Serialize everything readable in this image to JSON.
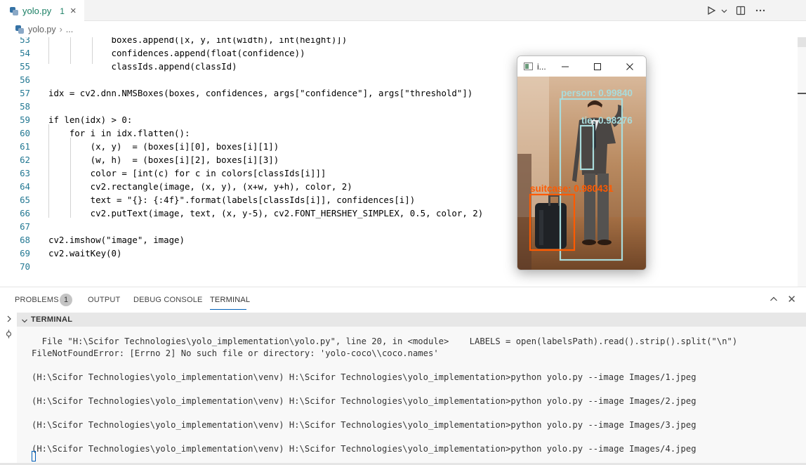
{
  "tab": {
    "label": "yolo.py",
    "badge": "1",
    "close": "×",
    "icon": "python-file-icon"
  },
  "toolbar": {
    "run_icon": "run-icon",
    "dropdown_icon": "chevron-down-icon",
    "split_icon": "split-editor-icon",
    "more_icon": "more-actions-icon"
  },
  "breadcrumb": {
    "file": "yolo.py",
    "sep": "›",
    "more": "..."
  },
  "editor": {
    "lines": [
      {
        "n": "53",
        "text": "            boxes.append([x, y, int(width), int(height)])"
      },
      {
        "n": "54",
        "text": "            confidences.append(float(confidence))"
      },
      {
        "n": "55",
        "text": "            classIds.append(classId)"
      },
      {
        "n": "56",
        "text": ""
      },
      {
        "n": "57",
        "text": "idx = cv2.dnn.NMSBoxes(boxes, confidences, args[\"confidence\"], args[\"threshold\"])"
      },
      {
        "n": "58",
        "text": ""
      },
      {
        "n": "59",
        "text": "if len(idx) > 0:"
      },
      {
        "n": "60",
        "text": "    for i in idx.flatten():"
      },
      {
        "n": "61",
        "text": "        (x, y)  = (boxes[i][0], boxes[i][1])"
      },
      {
        "n": "62",
        "text": "        (w, h)  = (boxes[i][2], boxes[i][3])"
      },
      {
        "n": "63",
        "text": "        color = [int(c) for c in colors[classIds[i]]]"
      },
      {
        "n": "64",
        "text": "        cv2.rectangle(image, (x, y), (x+w, y+h), color, 2)"
      },
      {
        "n": "65",
        "text": "        text = \"{}: {:4f}\".format(labels[classIds[i]], confidences[i])"
      },
      {
        "n": "66",
        "text": "        cv2.putText(image, text, (x, y-5), cv2.FONT_HERSHEY_SIMPLEX, 0.5, color, 2)"
      },
      {
        "n": "67",
        "text": ""
      },
      {
        "n": "68",
        "text": "cv2.imshow(\"image\", image)"
      },
      {
        "n": "69",
        "text": "cv2.waitKey(0)"
      },
      {
        "n": "70",
        "text": ""
      }
    ]
  },
  "image_window": {
    "title": "i...",
    "minimize": "—",
    "maximize": "☐",
    "close": "✕",
    "detections": [
      {
        "label": "person: 0.99840",
        "color": "#a9dcdc"
      },
      {
        "label": "tie: 0.98276",
        "color": "#a9dcdc"
      },
      {
        "label": "suitcase: 0.980431",
        "color": "#ff5a00"
      }
    ]
  },
  "panel": {
    "tabs": {
      "problems": "PROBLEMS",
      "problems_count": "1",
      "output": "OUTPUT",
      "debug": "DEBUG CONSOLE",
      "terminal": "TERMINAL"
    },
    "up_icon": "chevron-up-icon",
    "close": "✕"
  },
  "terminal": {
    "header": "TERMINAL",
    "lines": [
      "  File \"H:\\Scifor Technologies\\yolo_implementation\\yolo.py\", line 20, in <module>    LABELS = open(labelsPath).read().strip().split(\"\\n\")",
      "FileNotFoundError: [Errno 2] No such file or directory: 'yolo-coco\\\\coco.names'",
      "",
      "(H:\\Scifor Technologies\\yolo_implementation\\venv) H:\\Scifor Technologies\\yolo_implementation>python yolo.py --image Images/1.jpeg",
      "",
      "(H:\\Scifor Technologies\\yolo_implementation\\venv) H:\\Scifor Technologies\\yolo_implementation>python yolo.py --image Images/2.jpeg",
      "",
      "(H:\\Scifor Technologies\\yolo_implementation\\venv) H:\\Scifor Technologies\\yolo_implementation>python yolo.py --image Images/3.jpeg",
      "",
      "(H:\\Scifor Technologies\\yolo_implementation\\venv) H:\\Scifor Technologies\\yolo_implementation>python yolo.py --image Images/4.jpeg"
    ]
  }
}
